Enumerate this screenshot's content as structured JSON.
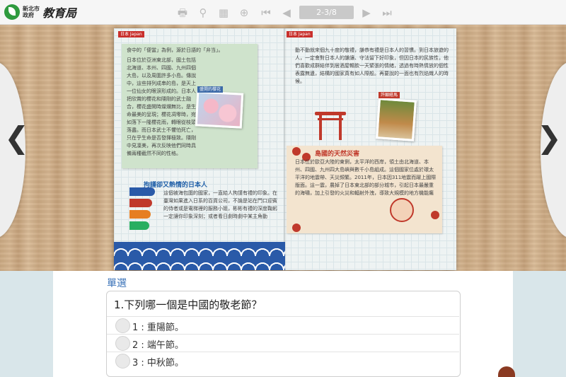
{
  "logo": {
    "line1": "新北市",
    "line2": "政府",
    "brush": "教育局"
  },
  "toolbar": {
    "page_indicator": "2-3/8",
    "icons": {
      "print": "printer-icon",
      "search": "search-icon",
      "grid": "grid-icon",
      "zoom": "zoom-in-icon",
      "first": "first-page-icon",
      "prev": "prev-page-icon",
      "next": "next-page-icon",
      "last": "last-page-icon"
    },
    "glyphs": {
      "print": "🖶",
      "search": "⚲",
      "grid": "▦",
      "zoom": "⊕",
      "first": "⏮",
      "prev": "◀",
      "next": "▶",
      "last": "⏭"
    }
  },
  "nav": {
    "prev": "❮",
    "next": "❯"
  },
  "book": {
    "left_tag": "日本 Japan",
    "right_tag": "日本 Japan",
    "left_para1": "食中的「便當」為例，源於日語的「弁当」。",
    "left_para2": "日本位於亞洲東北部，國土包括北海道、本州、四國、九州四個大島，以及周圍許多小島。傳說中，這些排列成串的島，是天上一位仙女的眼淚形成的。日本人把欣賞的櫻花和隱剛的武士融合，櫻花盛開時燦爛無比，是生命最美的呈現；櫻花凋零時，宛如落下一隆櫻花雨，轉眼從枝頭落盡。而日本武士不懼怕死亡，只在乎生命是否發揮極致。隱剛中見凜美，再次反映他們同時具備兩種截然不同的性格。",
    "sakura_caption": "盛開的櫻花",
    "section2_title": "拘謹卻又熱情的日本人",
    "left_para3": "這個被海包圍的國家，一直給人拘謹有禮的印象。在臺灣如果進入日系的百貨公司，不論是站在門口迎賓的侍者或是電梯裡的服務小姐，彬彬有禮的深度鞠躬一定讓你印象深刻；或者看日劇時劇中某主角動",
    "right_para1": "動不動就來個九十度的敬禮，謙恭有禮是日本人的習慣。到日本旅遊的人，一定會對日本人的謙讓、守法留下好印象，但因日本的民族性，他們喜歡成群結伴到居酒屋暢飲一天緊張的情緒，透過有時熱情放的個性表露無遺，結構的國家真有如人際般。再要說的一面也有烈焰熾人的時候。",
    "shrine_caption": "許願繪馬",
    "section3_title": "島國的天然災害",
    "right_para2": "日本位於歐亞大陸的東側，太平洋的西岸，領土由北海道、本州、四國、九州四大島嶼與數千小島組成。這個國家位處於環太平洋的地震帶、天災頻繁。2011年，日本因311地震而躍上國際版面。這一震，農掉了日本東北部的部分城市，引起日本最嚴重的海嘯，加上引發的火災和輻射外洩，導致大規模的地方機能癱"
  },
  "quiz": {
    "type_label": "單選",
    "question": "1.下列哪一個是中國的敬老節？",
    "options": [
      "1 : 重陽節。",
      "2 : 端午節。",
      "3 : 中秋節。"
    ]
  },
  "colors": {
    "accent": "#3a72b8",
    "brand_green": "#2e9a3e",
    "japan_red": "#c0392b",
    "wave_blue": "#2a5aa8"
  }
}
